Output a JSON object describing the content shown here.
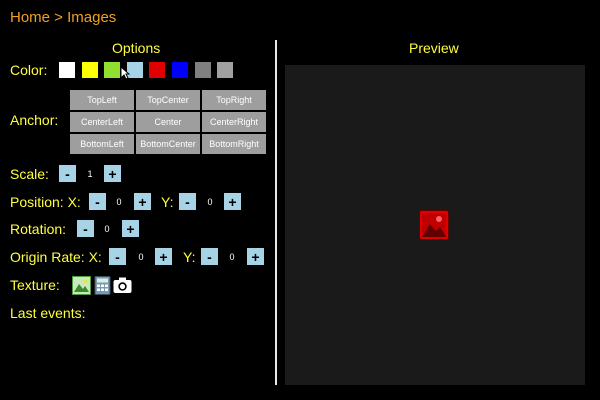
{
  "breadcrumb": "Home > Images",
  "options": {
    "title": "Options",
    "color_label": "Color:",
    "swatches": [
      "#ffffff",
      "#ffff00",
      "#90e030",
      "#a6d4e6",
      "#e00000",
      "#0000ff",
      "#808080",
      "#a0a0a0"
    ],
    "anchor_label": "Anchor:",
    "anchors": [
      "TopLeft",
      "TopCenter",
      "TopRight",
      "CenterLeft",
      "Center",
      "CenterRight",
      "BottomLeft",
      "BottomCenter",
      "BottomRight"
    ],
    "scale_label": "Scale:",
    "scale_value": "1",
    "position_label": "Position: X:",
    "position_x": "0",
    "y_label": "Y:",
    "position_y": "0",
    "rotation_label": "Rotation:",
    "rotation_value": "0",
    "origin_label": "Origin Rate: X:",
    "origin_x": "0",
    "origin_y": "0",
    "texture_label": "Texture:",
    "textures": [
      "image-icon",
      "calculator-icon",
      "camera-icon"
    ],
    "last_events_label": "Last events:",
    "minus": "-",
    "plus": "+"
  },
  "preview": {
    "title": "Preview",
    "image_icon": "image-icon",
    "image_color": "#e00000"
  }
}
